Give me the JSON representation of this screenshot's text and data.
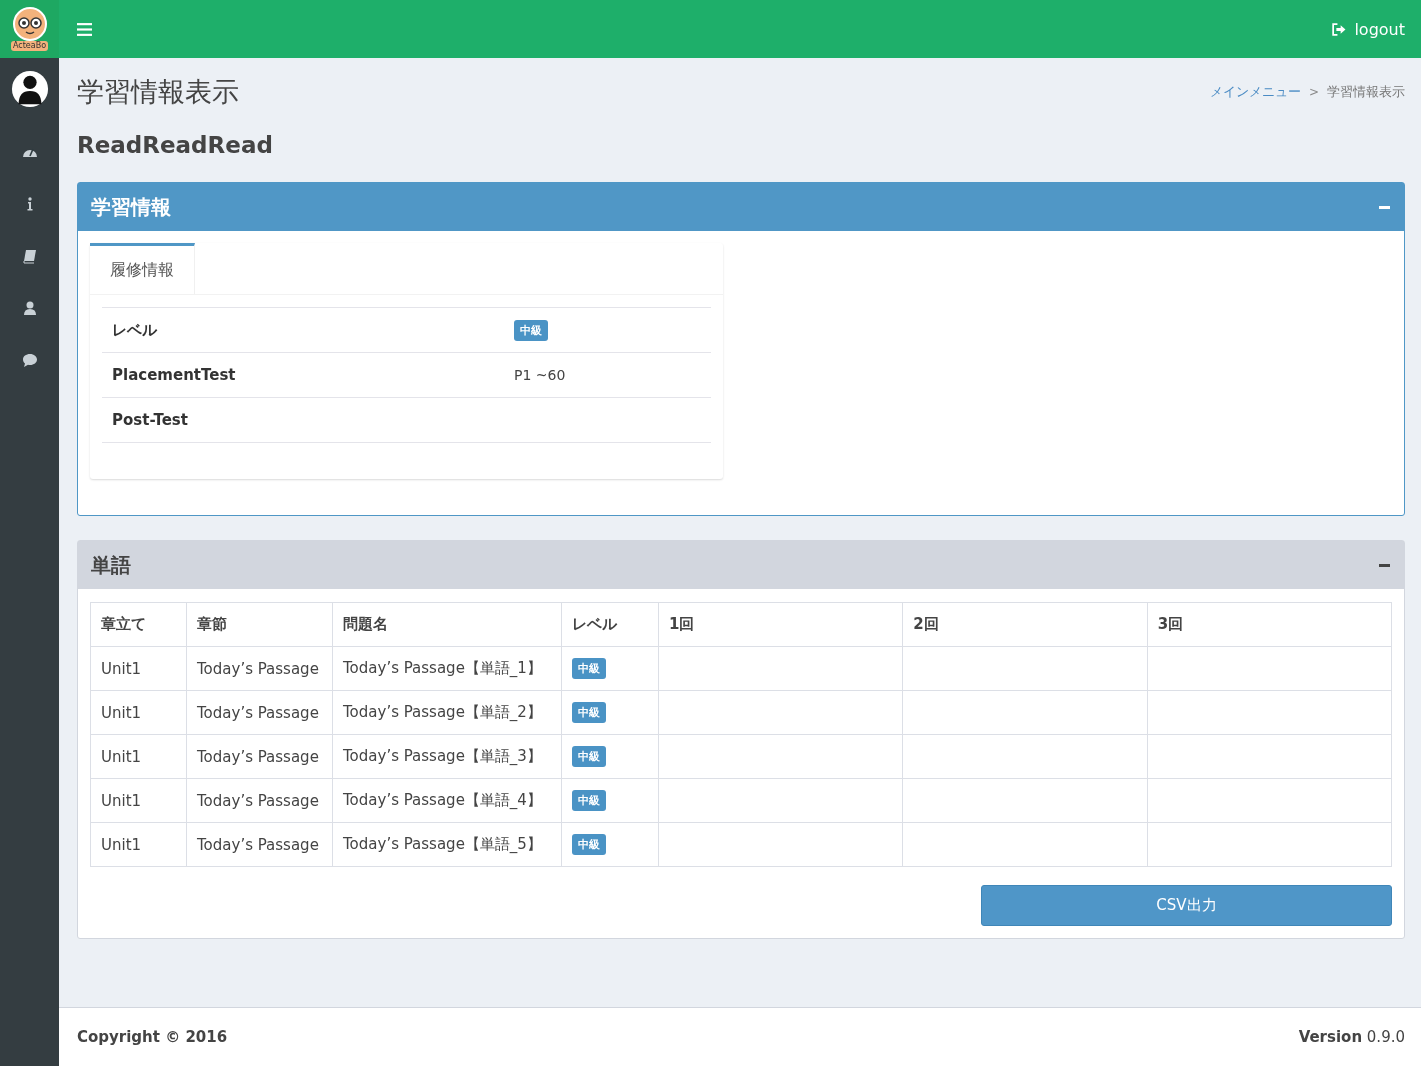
{
  "logo": {
    "text": "ActeaBo"
  },
  "topbar": {
    "logout": "logout"
  },
  "sidebar": {
    "items": [
      {
        "kind": "dashboard"
      },
      {
        "kind": "info"
      },
      {
        "kind": "book"
      },
      {
        "kind": "user"
      },
      {
        "kind": "chat"
      }
    ]
  },
  "page": {
    "title": "学習情報表示",
    "breadcrumb_separator": ">",
    "breadcrumb": [
      {
        "label": "メインメニュー",
        "link": true
      },
      {
        "label": "学習情報表示",
        "link": false
      }
    ],
    "subtitle": "ReadReadRead"
  },
  "study_box": {
    "title": "学習情報",
    "tabs": [
      {
        "label": "履修情報",
        "selected": true
      }
    ],
    "rows": [
      {
        "label": "レベル",
        "value": "中級",
        "kind": "badge"
      },
      {
        "label": "PlacementTest",
        "value": "P1 ~60",
        "kind": "text"
      },
      {
        "label": "Post-Test",
        "value": "",
        "kind": "text"
      }
    ]
  },
  "word_box": {
    "title": "単語",
    "columns": [
      "章立て",
      "章節",
      "問題名",
      "レベル",
      "1回",
      "2回",
      "3回"
    ],
    "rows": [
      [
        "Unit1",
        "Today’s Passage",
        "Today’s Passage【単語_1】",
        "中級",
        "",
        "",
        ""
      ],
      [
        "Unit1",
        "Today’s Passage",
        "Today’s Passage【単語_2】",
        "中級",
        "",
        "",
        ""
      ],
      [
        "Unit1",
        "Today’s Passage",
        "Today’s Passage【単語_3】",
        "中級",
        "",
        "",
        ""
      ],
      [
        "Unit1",
        "Today’s Passage",
        "Today’s Passage【単語_4】",
        "中級",
        "",
        "",
        ""
      ],
      [
        "Unit1",
        "Today’s Passage",
        "Today’s Passage【単語_5】",
        "中級",
        "",
        "",
        ""
      ]
    ],
    "button": "CSV出力"
  },
  "footer": {
    "copyright": "Copyright © 2016",
    "version_label": "Version",
    "version": "0.9.0"
  }
}
